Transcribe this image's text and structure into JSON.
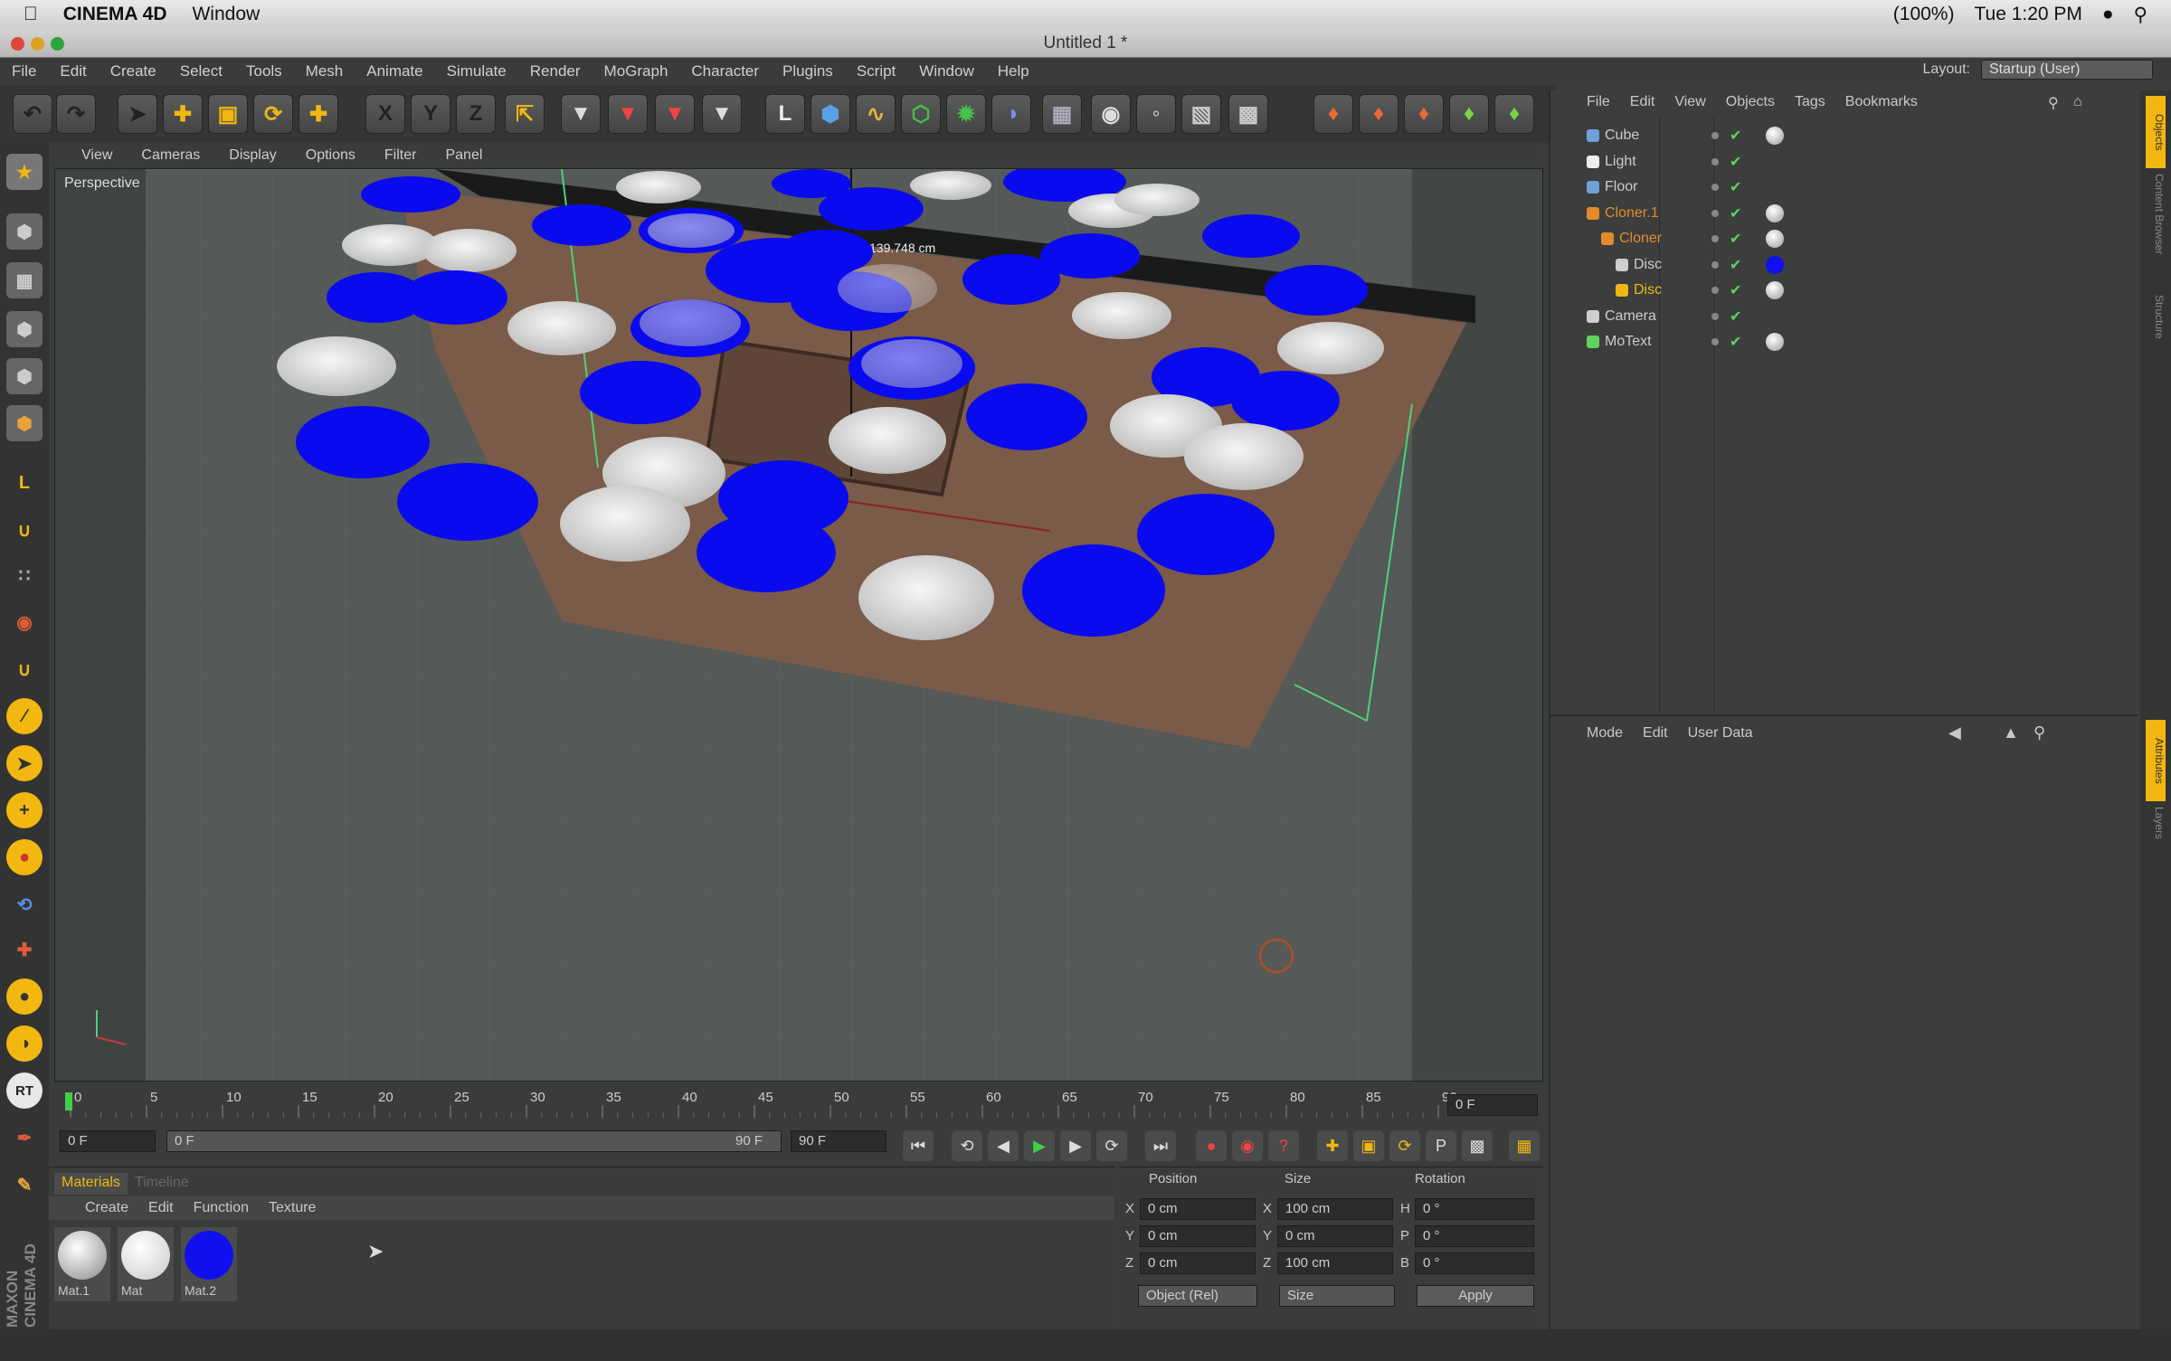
{
  "mac_menubar": {
    "app_name": "CINEMA 4D",
    "window_menu": "Window",
    "battery": "(100%)",
    "clock": "Tue 1:20 PM"
  },
  "window": {
    "title": "Untitled 1 *"
  },
  "main_menu": [
    "File",
    "Edit",
    "Create",
    "Select",
    "Tools",
    "Mesh",
    "Animate",
    "Simulate",
    "Render",
    "MoGraph",
    "Character",
    "Plugins",
    "Script",
    "Window",
    "Help"
  ],
  "layout": {
    "label": "Layout:",
    "value": "Startup (User)"
  },
  "toolbar": {
    "x_axis": "X",
    "y_axis": "Y",
    "z_axis": "Z"
  },
  "viewport": {
    "menu": [
      "View",
      "Cameras",
      "Display",
      "Options",
      "Filter",
      "Panel"
    ],
    "camera_label": "Perspective",
    "measure": "139.748 cm"
  },
  "timeline": {
    "ticks": [
      "0",
      "5",
      "10",
      "15",
      "20",
      "25",
      "30",
      "35",
      "40",
      "45",
      "50",
      "55",
      "60",
      "65",
      "70",
      "75",
      "80",
      "85",
      "90"
    ],
    "current_frame": "0 F",
    "start": "0 F",
    "range_start": "0 F",
    "range_end": "90 F",
    "end": "90 F"
  },
  "materials": {
    "tabs": [
      "Materials",
      "Timeline"
    ],
    "menu": [
      "Create",
      "Edit",
      "Function",
      "Texture"
    ],
    "items": [
      {
        "name": "Mat.1",
        "color": "#cfd0cf"
      },
      {
        "name": "Mat",
        "color": "#efefef"
      },
      {
        "name": "Mat.2",
        "color": "#1010ee"
      }
    ]
  },
  "coords": {
    "headers": [
      "Position",
      "Size",
      "Rotation"
    ],
    "rows": [
      {
        "axis": "X",
        "pos": "0 cm",
        "sa": "X",
        "size": "100 cm",
        "ra": "H",
        "rot": "0 °"
      },
      {
        "axis": "Y",
        "pos": "0 cm",
        "sa": "Y",
        "size": "0 cm",
        "ra": "P",
        "rot": "0 °"
      },
      {
        "axis": "Z",
        "pos": "0 cm",
        "sa": "Z",
        "size": "100 cm",
        "ra": "B",
        "rot": "0 °"
      }
    ],
    "mode": "Object (Rel)",
    "size_mode": "Size",
    "apply": "Apply"
  },
  "object_manager": {
    "menu": [
      "File",
      "Edit",
      "View",
      "Objects",
      "Tags",
      "Bookmarks"
    ],
    "objects": [
      {
        "name": "Cube",
        "color": "#6fa0d8"
      },
      {
        "name": "Light",
        "color": "#eeeeee"
      },
      {
        "name": "Floor",
        "color": "#6fa0d8"
      },
      {
        "name": "Cloner.1",
        "color": "#e58a2b"
      },
      {
        "name": "Cloner",
        "color": "#e58a2b"
      },
      {
        "name": "Disc",
        "color": "#cfcfcf"
      },
      {
        "name": "Disc",
        "color": "#f2b711"
      },
      {
        "name": "Camera",
        "color": "#cfcfcf"
      },
      {
        "name": "MoText",
        "color": "#5fd35f"
      }
    ]
  },
  "attribute_manager": {
    "menu": [
      "Mode",
      "Edit",
      "User Data"
    ]
  },
  "right_tabs": [
    "Objects",
    "Content Browser",
    "Structure",
    "Attributes",
    "Layers"
  ],
  "branding": "MAXON CINEMA 4D",
  "colors": {
    "accent": "#f2b711",
    "disc_blue": "#0a0aee",
    "disc_white": "#e8e8e8",
    "cube": "#7a5a48"
  }
}
